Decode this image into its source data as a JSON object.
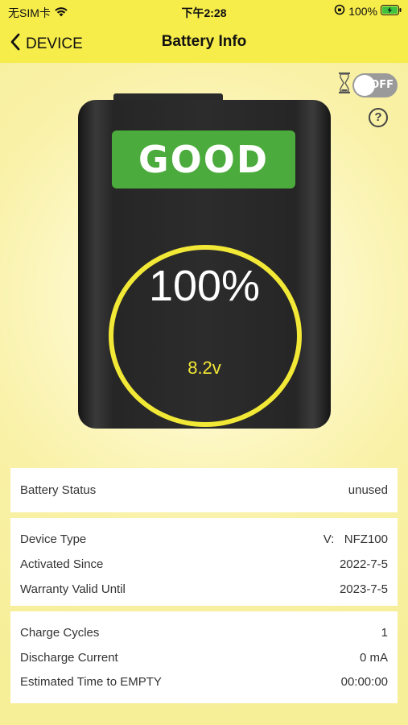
{
  "status_bar": {
    "carrier": "无SIM卡",
    "time": "下午2:28",
    "battery_percent": "100%"
  },
  "nav": {
    "back_label": "DEVICE",
    "title": "Battery Info"
  },
  "toggle": {
    "label": "OFF",
    "on": false
  },
  "battery": {
    "health": "GOOD",
    "percent": "100%",
    "voltage": "8.2v",
    "health_color": "#4bab3c",
    "ring_color": "#f2e836"
  },
  "status_card": {
    "rows": [
      {
        "label": "Battery Status",
        "value": "unused"
      }
    ]
  },
  "device_card": {
    "rows": [
      {
        "label": "Device Type",
        "value": "V:   NFZ100"
      },
      {
        "label": "Activated Since",
        "value": "2022-7-5"
      },
      {
        "label": "Warranty Valid Until",
        "value": "2023-7-5"
      }
    ]
  },
  "usage_card": {
    "rows": [
      {
        "label": "Charge Cycles",
        "value": "1"
      },
      {
        "label": "Discharge Current",
        "value": "0 mA"
      },
      {
        "label": "Estimated Time to EMPTY",
        "value": "00:00:00"
      }
    ]
  },
  "colors": {
    "accent_yellow": "#f6ec4a",
    "background": "#f7ef9a"
  }
}
